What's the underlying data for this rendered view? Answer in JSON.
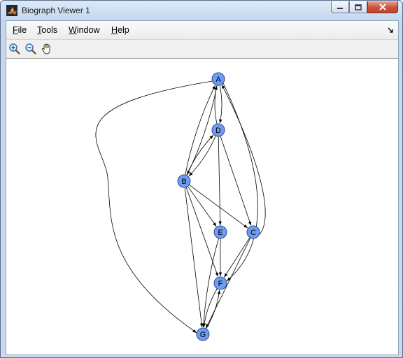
{
  "window": {
    "title": "Biograph Viewer 1",
    "app_icon": "matlab-icon"
  },
  "menu": {
    "items": [
      {
        "label": "File",
        "mnemonic": "F",
        "rest": "ile"
      },
      {
        "label": "Tools",
        "mnemonic": "T",
        "rest": "ools"
      },
      {
        "label": "Window",
        "mnemonic": "W",
        "rest": "indow"
      },
      {
        "label": "Help",
        "mnemonic": "H",
        "rest": "elp"
      }
    ]
  },
  "toolbar": {
    "tools": [
      "zoom-in-icon",
      "zoom-out-icon",
      "pan-hand-icon"
    ]
  },
  "graph": {
    "nodes": [
      "A",
      "D",
      "B",
      "E",
      "C",
      "F",
      "G"
    ],
    "edges": [
      [
        "A",
        "D"
      ],
      [
        "D",
        "A"
      ],
      [
        "A",
        "B"
      ],
      [
        "B",
        "A"
      ],
      [
        "A",
        "G"
      ],
      [
        "C",
        "A"
      ],
      [
        "D",
        "B"
      ],
      [
        "B",
        "D"
      ],
      [
        "D",
        "E"
      ],
      [
        "D",
        "C"
      ],
      [
        "B",
        "E"
      ],
      [
        "B",
        "C"
      ],
      [
        "B",
        "F"
      ],
      [
        "B",
        "G"
      ],
      [
        "E",
        "F"
      ],
      [
        "E",
        "G"
      ],
      [
        "C",
        "F"
      ],
      [
        "C",
        "G"
      ],
      [
        "A",
        "F"
      ],
      [
        "G",
        "F"
      ],
      [
        "F",
        "G"
      ]
    ]
  }
}
